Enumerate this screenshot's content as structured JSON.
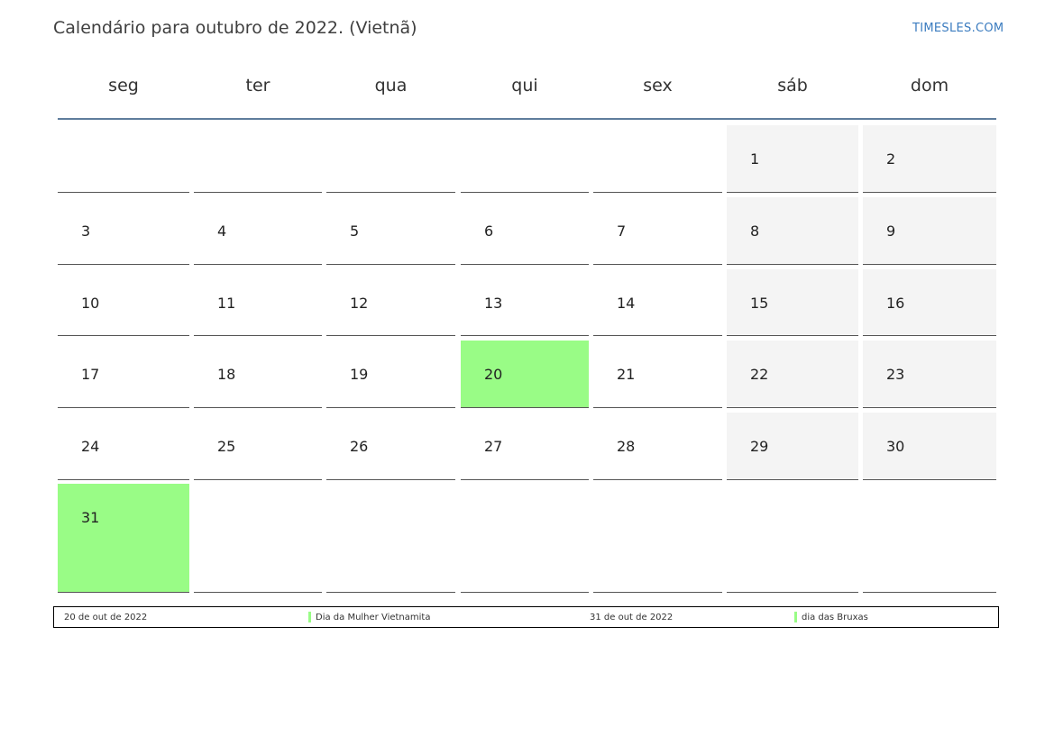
{
  "title": "Calendário para outubro de 2022. (Vietnã)",
  "brand": "TIMESLES.COM",
  "weekdays": [
    "seg",
    "ter",
    "qua",
    "qui",
    "sex",
    "sáb",
    "dom"
  ],
  "days": {
    "d1": "1",
    "d2": "2",
    "d3": "3",
    "d4": "4",
    "d5": "5",
    "d6": "6",
    "d7": "7",
    "d8": "8",
    "d9": "9",
    "d10": "10",
    "d11": "11",
    "d12": "12",
    "d13": "13",
    "d14": "14",
    "d15": "15",
    "d16": "16",
    "d17": "17",
    "d18": "18",
    "d19": "19",
    "d20": "20",
    "d21": "21",
    "d22": "22",
    "d23": "23",
    "d24": "24",
    "d25": "25",
    "d26": "26",
    "d27": "27",
    "d28": "28",
    "d29": "29",
    "d30": "30",
    "d31": "31"
  },
  "holidays": [
    {
      "date": "20 de out de 2022",
      "name": "Dia da Mulher Vietnamita"
    },
    {
      "date": "31 de out de 2022",
      "name": "dia das Bruxas"
    }
  ],
  "colors": {
    "holiday": "#99fc86",
    "weekend": "#f4f4f4",
    "header_line": "#5f7d9c",
    "brand": "#3a7bbf"
  }
}
